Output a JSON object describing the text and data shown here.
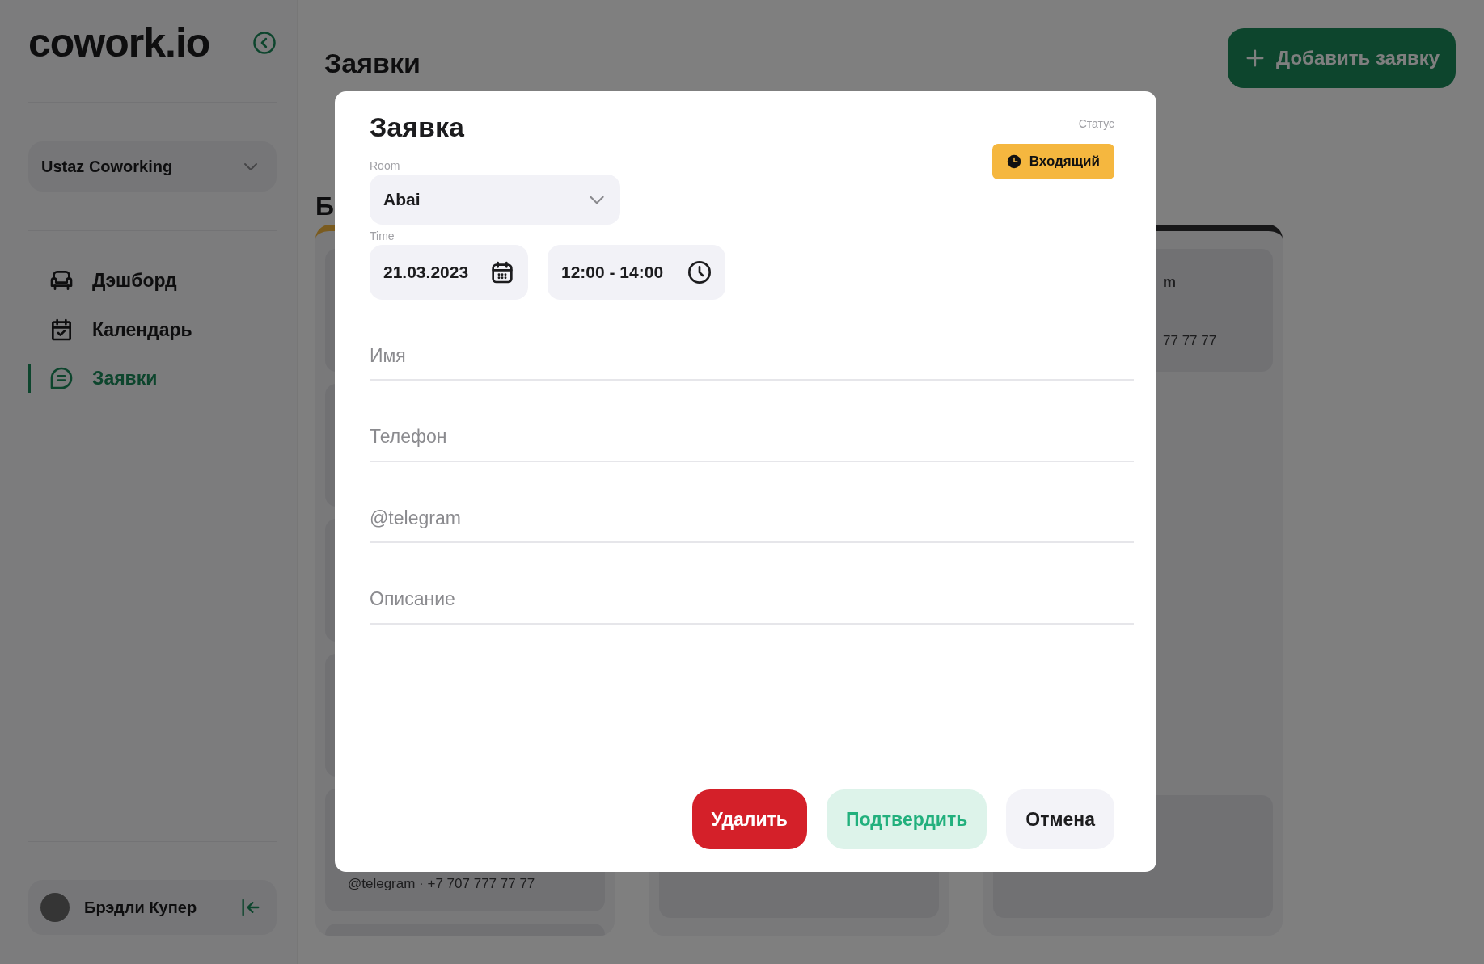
{
  "sidebar": {
    "logo": "cowork.io",
    "workspace": {
      "value": "Ustaz Coworking"
    },
    "nav": [
      {
        "label": "Дэшборд",
        "selected": false
      },
      {
        "label": "Календарь",
        "selected": false
      },
      {
        "label": "Заявки",
        "selected": true
      }
    ],
    "user": {
      "name": "Брэдли Купер"
    }
  },
  "main": {
    "title": "Заявки",
    "add_button": "Добавить заявку",
    "board": {
      "heading": "Б",
      "first_column_cards": [
        {
          "lines": [
            "@telegram · +7 707 777 77 77"
          ]
        }
      ],
      "third_column_cards": [
        {
          "lines": [
            "m",
            "77 77 77"
          ]
        }
      ]
    }
  },
  "modal": {
    "title": "Заявка",
    "status_label": "Статус",
    "status": {
      "label": "Входящий",
      "color": "#f5b73f"
    },
    "room": {
      "label": "Room",
      "value": "Abai"
    },
    "time": {
      "label": "Time",
      "date": "21.03.2023",
      "range": "12:00 - 14:00"
    },
    "fields": [
      {
        "placeholder": "Имя"
      },
      {
        "placeholder": "Телефон"
      },
      {
        "placeholder": "@telegram"
      },
      {
        "placeholder": "Описание"
      }
    ],
    "buttons": [
      {
        "label": "Удалить",
        "kind": "danger"
      },
      {
        "label": "Подтвердить",
        "kind": "confirm"
      },
      {
        "label": "Отмена",
        "kind": "cancel"
      }
    ]
  }
}
